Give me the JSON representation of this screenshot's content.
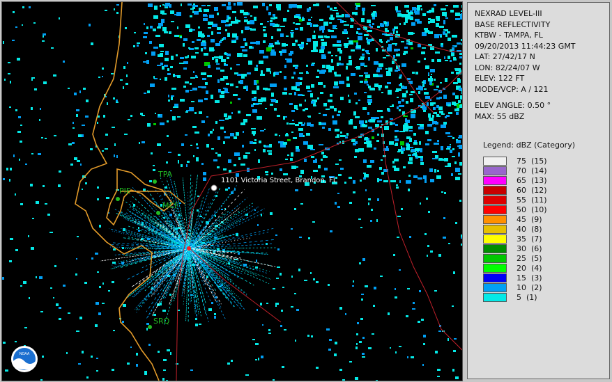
{
  "info": {
    "line1": "NEXRAD LEVEL-III",
    "line2": "BASE REFLECTIVITY",
    "line3": "KTBW - TAMPA, FL",
    "line4": "09/20/2013 11:44:23 GMT",
    "line5": "LAT: 27/42/17 N",
    "line6": "LON: 82/24/07 W",
    "line7": "ELEV: 122 FT",
    "line8": "MODE/VCP: A / 121",
    "line9": "ELEV ANGLE: 0.50 °",
    "line10": "MAX: 55 dBZ"
  },
  "legend": {
    "title": "Legend: dBZ (Category)",
    "items": [
      {
        "label": "75  (15)",
        "color": "#f0f0f0"
      },
      {
        "label": "70  (14)",
        "color": "#9966cc"
      },
      {
        "label": "65  (13)",
        "color": "#ff00ff"
      },
      {
        "label": "60  (12)",
        "color": "#c80000"
      },
      {
        "label": "55  (11)",
        "color": "#dd0000"
      },
      {
        "label": "50  (10)",
        "color": "#ff0000"
      },
      {
        "label": "45  (9)",
        "color": "#ff9000"
      },
      {
        "label": "40  (8)",
        "color": "#e7c000"
      },
      {
        "label": "35  (7)",
        "color": "#ffff00"
      },
      {
        "label": "30  (6)",
        "color": "#008e00"
      },
      {
        "label": "25  (5)",
        "color": "#00c800"
      },
      {
        "label": "20  (4)",
        "color": "#00ff00"
      },
      {
        "label": "15  (3)",
        "color": "#0000f6"
      },
      {
        "label": "10  (2)",
        "color": "#019ff4"
      },
      {
        "label": "5  (1)",
        "color": "#04e9e7"
      }
    ]
  },
  "map": {
    "cities": [
      "TPA",
      "PIE",
      "MCF",
      "SRQ"
    ],
    "address": "1101 Victoria Street, Brandon, FL",
    "logo": "NOAA"
  }
}
